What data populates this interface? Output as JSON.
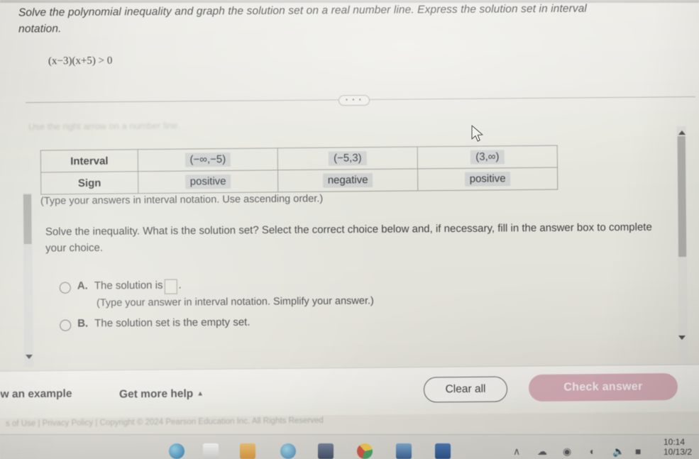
{
  "problem": {
    "prompt_part1": "Solve the polynomial inequality and graph the solution set on a real number line. Express the solution set in interval",
    "prompt_part2": "notation.",
    "equation": "(x−3)(x+5) > 0",
    "faint_line": "Use the right arrow on a number line."
  },
  "toolbar": {
    "more_options": "• • •"
  },
  "sign_table": {
    "row_labels": [
      "Interval",
      "Sign"
    ],
    "intervals": [
      "(−∞,−5)",
      "(−5,3)",
      "(3,∞)"
    ],
    "signs": [
      "positive",
      "negative",
      "positive"
    ],
    "note": "(Type your answers in interval notation. Use ascending order.)"
  },
  "question": {
    "text": "Solve the inequality. What is the solution set? Select the correct choice below and, if necessary, fill in the answer box to complete your choice.",
    "choices": [
      {
        "letter": "A.",
        "text": "The solution is",
        "trailing": ".",
        "hint": "(Type your answer in interval notation. Simplify your answer.)",
        "has_input": true,
        "input_value": "",
        "selected": false
      },
      {
        "letter": "B.",
        "text": "The solution set is the empty set.",
        "trailing": "",
        "hint": "",
        "has_input": false,
        "input_value": "",
        "selected": false
      }
    ]
  },
  "footer": {
    "view_example": "ew an example",
    "get_more_help": "Get more help",
    "get_more_help_caret": "▲",
    "clear_all": "Clear all",
    "check_answer": "Check answer",
    "copyright": "s of Use | Privacy Policy | Copyright © 2024 Pearson Education Inc. All Rights Reserved"
  },
  "taskbar": {
    "tray_caret": "∧",
    "time": "10:14",
    "date": "10/13/2",
    "icons": [
      {
        "name": "edge-icon",
        "color": "#2e7bc4"
      },
      {
        "name": "explorer-icon",
        "color": "#e8e8e6"
      },
      {
        "name": "file-folder-icon",
        "color": "#e8a33d"
      },
      {
        "name": "teams-icon",
        "color": "#4a90c2"
      },
      {
        "name": "photos-icon",
        "color": "#5a6b8c"
      },
      {
        "name": "chrome-icon",
        "color": "#d9463a"
      },
      {
        "name": "outlook-icon",
        "color": "#3d6fa8"
      },
      {
        "name": "word-icon",
        "color": "#2b579a"
      }
    ]
  },
  "colors": {
    "paper": "#efeee6",
    "check_answer_bg": "#dcaab6",
    "cell_highlight": "#d3d5d6",
    "text": "#3a3a3c"
  }
}
